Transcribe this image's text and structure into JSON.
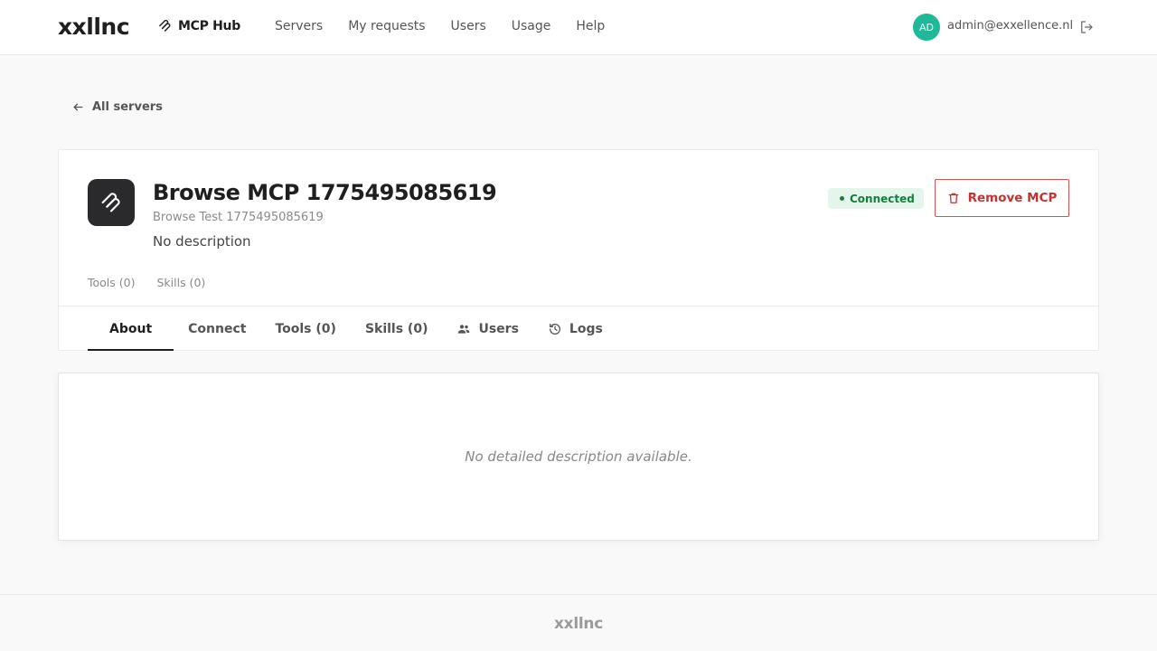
{
  "header": {
    "logo": "xxllnc",
    "hub_label": "MCP Hub",
    "nav": [
      "Servers",
      "My requests",
      "Users",
      "Usage",
      "Help"
    ],
    "avatar_initials": "AD",
    "avatar_color": "#1fb899",
    "user_email": "admin@exxellence.nl"
  },
  "back": {
    "label": "All servers"
  },
  "server": {
    "title": "Browse MCP 1775495085619",
    "subtitle": "Browse Test 1775495085619",
    "description": "No description",
    "status": "Connected",
    "status_color": "#15803d",
    "remove_label": "Remove MCP",
    "remove_color": "#c53030",
    "counts": {
      "tools": "Tools (0)",
      "skills": "Skills (0)"
    }
  },
  "tabs": [
    {
      "label": "About",
      "active": true
    },
    {
      "label": "Connect"
    },
    {
      "label": "Tools (0)"
    },
    {
      "label": "Skills (0)"
    },
    {
      "label": "Users",
      "icon": "users-icon"
    },
    {
      "label": "Logs",
      "icon": "history-icon"
    }
  ],
  "panel": {
    "empty_text": "No detailed description available."
  },
  "footer": {
    "logo": "xxllnc"
  }
}
